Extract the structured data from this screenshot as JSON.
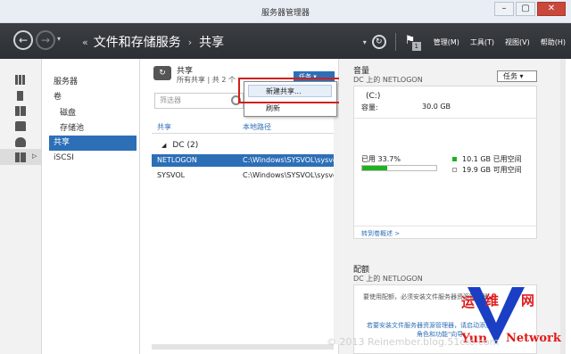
{
  "window": {
    "title": "服务器管理器",
    "minimize": "–",
    "maximize": "▢",
    "close": "✕"
  },
  "header": {
    "back": "←",
    "forward": "→",
    "history_dropdown": "▾",
    "breadcrumb_prefix": "«",
    "breadcrumb": [
      "文件和存储服务",
      "共享"
    ],
    "breadcrumb_sep": "›",
    "refresh_dropdown": "▾",
    "refresh": "↻",
    "notifications_count": "1",
    "menus": [
      "管理(M)",
      "工具(T)",
      "视图(V)",
      "帮助(H)"
    ]
  },
  "sidebar": {
    "items": [
      {
        "label": "服务器"
      },
      {
        "label": "卷"
      },
      {
        "label": "磁盘"
      },
      {
        "label": "存储池"
      },
      {
        "label": "共享"
      },
      {
        "label": "iSCSI"
      }
    ],
    "selected": "共享"
  },
  "shares": {
    "title": "共享",
    "subtitle": "所有共享 | 共 2 个",
    "tasks_label": "任务",
    "filter_placeholder": "筛选器",
    "columns": [
      "共享",
      "本地路径"
    ],
    "group": "DC (2)",
    "rows": [
      {
        "name": "NETLOGON",
        "path": "C:\\Windows\\SYSVOL\\sysvo",
        "selected": true
      },
      {
        "name": "SYSVOL",
        "path": "C:\\Windows\\SYSVOL\\sysvo",
        "selected": false
      }
    ]
  },
  "dropdown": {
    "items": [
      "新建共享...",
      "刷新"
    ]
  },
  "volume": {
    "title": "音量",
    "subtitle": "DC 上的 NETLOGON",
    "tasks_label": "任务",
    "drive": "(C:)",
    "capacity_label": "容量:",
    "capacity": "30.0 GB",
    "used_label": "已用 33.7%",
    "used_fraction": 0.337,
    "used_space": "10.1 GB 已用空间",
    "free_space": "19.9 GB 可用空间",
    "link": "转到卷概述 >",
    "used_color": "#1fb21f",
    "free_color": "#ffffff"
  },
  "quota": {
    "title": "配额",
    "subtitle": "DC 上的 NETLOGON",
    "message": "要使用配额，必须安装文件服务器资源管理器。",
    "link_line1": "若要安装文件服务器资源管理器，请启动添加",
    "link_line2": "角色和功能\"向导。"
  },
  "watermark": {
    "copyright": "© 2013 Reinember.blog.51cto.com",
    "cn_left": "运",
    "cn_mid": "维",
    "cn_right": "网",
    "en_left": "Yun",
    "en_right": "Network",
    "letter": "V"
  }
}
